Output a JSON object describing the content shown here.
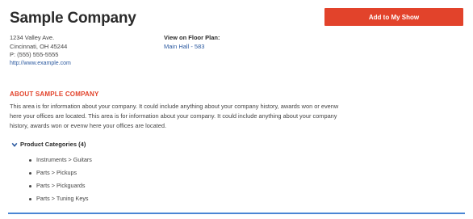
{
  "company": {
    "name": "Sample Company",
    "add_button_label": "Add to My Show"
  },
  "address": {
    "street": "1234 Valley Ave.",
    "city_state_zip": "Cincinnati, OH 45244",
    "phone": "P: (555) 555-5555",
    "website": "http://www.example.com"
  },
  "floor_plan": {
    "label": "View on Floor Plan:",
    "link": "Main Hall - 583"
  },
  "about": {
    "heading": "ABOUT SAMPLE COMPANY",
    "text": "This area is for information about your company. It could include anything about your company history, awards won or evenw here your offices are located. This area is for information about your company. It could include anything about your company history, awards won or evenw here your offices are located."
  },
  "categories": {
    "label": "Product Categories (4)",
    "items": [
      "Instruments > Guitars",
      "Parts > Pickups",
      "Parts > Pickguards",
      "Parts > Tuning Keys"
    ]
  },
  "colors": {
    "accent": "#e2432b",
    "link": "#2c5aa0",
    "rule": "#4a86d4"
  }
}
